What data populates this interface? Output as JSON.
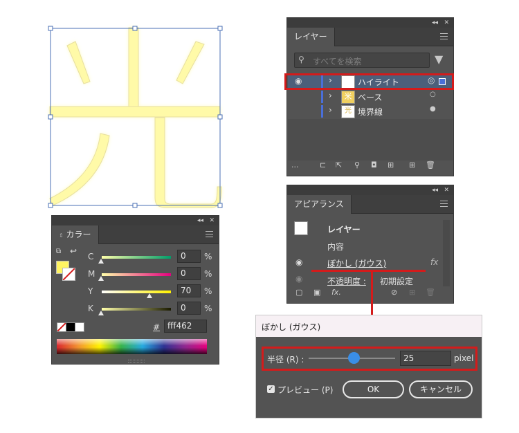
{
  "canvas": {
    "glyph": "光"
  },
  "layers_panel": {
    "tab": "レイヤー",
    "search_placeholder": "すべてを検索",
    "layers": [
      {
        "name": "ハイライト",
        "selected": true
      },
      {
        "name": "ベース",
        "selected": false
      },
      {
        "name": "境界線",
        "selected": false
      }
    ],
    "more_label": "...",
    "collapse_label": "◂◂",
    "close_label": "✕"
  },
  "appearance_panel": {
    "tab": "アピアランス",
    "target": "レイヤー",
    "content_label": "内容",
    "effect_label": "ぼかし (ガウス)",
    "fx_label": "fx",
    "opacity_label": "不透明度 :",
    "opacity_value": "初期設定",
    "add_effect_label": "fx."
  },
  "color_panel": {
    "tab": "カラー",
    "sliders": [
      {
        "label": "C",
        "value": "0",
        "unit": "%",
        "level": 0
      },
      {
        "label": "M",
        "value": "0",
        "unit": "%",
        "level": 0
      },
      {
        "label": "Y",
        "value": "70",
        "unit": "%",
        "level": 0.7
      },
      {
        "label": "K",
        "value": "0",
        "unit": "%",
        "level": 0
      }
    ],
    "hex_symbol": "#",
    "hex_value": "fff462",
    "fill_color": "#fff462"
  },
  "blur_dialog": {
    "title": "ぼかし (ガウス)",
    "radius_label": "半径 (R) :",
    "radius_value": "25",
    "radius_unit": "pixel",
    "radius_level": 0.5,
    "preview_label": "プレビュー (P)",
    "preview_checked": true,
    "ok_label": "OK",
    "cancel_label": "キャンセル"
  },
  "colors": {
    "highlight": "#d41b1b",
    "selection": "#4a6fb5",
    "panel": "#535353",
    "glyph_fill": "#fffaa8"
  }
}
